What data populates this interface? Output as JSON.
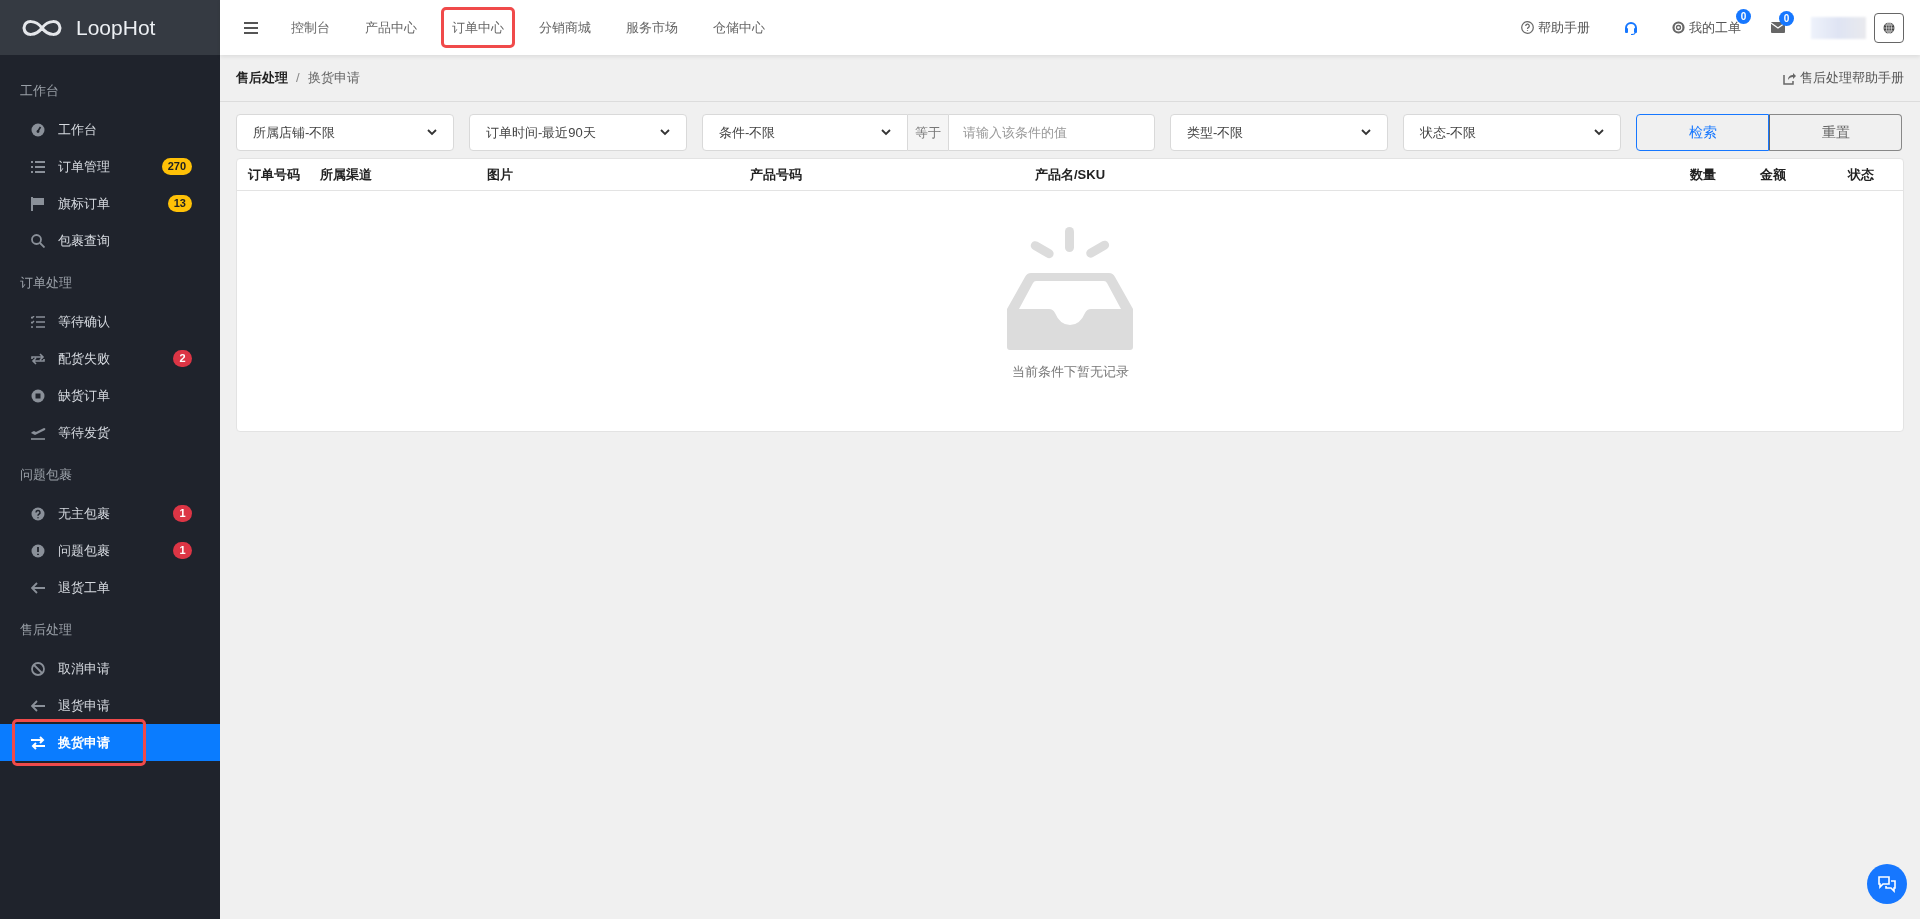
{
  "logo": {
    "text": "LoopHot"
  },
  "sidebar": {
    "sections": [
      {
        "title": "工作台",
        "items": [
          {
            "label": "工作台",
            "selected": false
          },
          {
            "label": "订单管理",
            "selected": false,
            "badge": "270",
            "color": "#ffc107"
          },
          {
            "label": "旗标订单",
            "selected": false,
            "badge": "13",
            "color": "#ffc107"
          },
          {
            "label": "包裹查询",
            "selected": false
          }
        ]
      },
      {
        "title": "订单处理",
        "items": [
          {
            "label": "等待确认",
            "selected": false
          },
          {
            "label": "配货失败",
            "selected": false,
            "badge": "2",
            "color": "#dc3545"
          },
          {
            "label": "缺货订单",
            "selected": false
          },
          {
            "label": "等待发货",
            "selected": false
          }
        ]
      },
      {
        "title": "问题包裹",
        "items": [
          {
            "label": "无主包裹",
            "selected": false,
            "badge": "1",
            "color": "#dc3545"
          },
          {
            "label": "问题包裹",
            "selected": false,
            "badge": "1",
            "color": "#dc3545"
          },
          {
            "label": "退货工单",
            "selected": false
          }
        ]
      },
      {
        "title": "售后处理",
        "items": [
          {
            "label": "取消申请",
            "selected": false
          },
          {
            "label": "退货申请",
            "selected": false
          },
          {
            "label": "换货申请",
            "selected": true,
            "highlighted": true
          }
        ]
      }
    ]
  },
  "top_nav": {
    "items": [
      {
        "label": "控制台",
        "highlighted": false
      },
      {
        "label": "产品中心",
        "highlighted": false
      },
      {
        "label": "订单中心",
        "highlighted": true
      },
      {
        "label": "分销商城",
        "highlighted": false
      },
      {
        "label": "服务市场",
        "highlighted": false
      },
      {
        "label": "仓储中心",
        "highlighted": false
      }
    ],
    "help": "帮助手册",
    "tickets": "我的工单",
    "tickets_badge": "0",
    "mail_badge": "0"
  },
  "breadcrumb": {
    "parent": "售后处理",
    "separator": "/",
    "current": "换货申请",
    "help_link": "售后处理帮助手册"
  },
  "filters": {
    "shop": "所属店铺-不限",
    "time": "订单时间-最近90天",
    "condition": "条件-不限",
    "equals": "等于",
    "value_placeholder": "请输入该条件的值",
    "type": "类型-不限",
    "status": "状态-不限",
    "search": "检索",
    "reset": "重置"
  },
  "table": {
    "columns": [
      "订单号码",
      "所属渠道",
      "图片",
      "产品号码",
      "产品名/SKU",
      "数量",
      "金额",
      "状态"
    ],
    "empty_text": "当前条件下暂无记录"
  }
}
